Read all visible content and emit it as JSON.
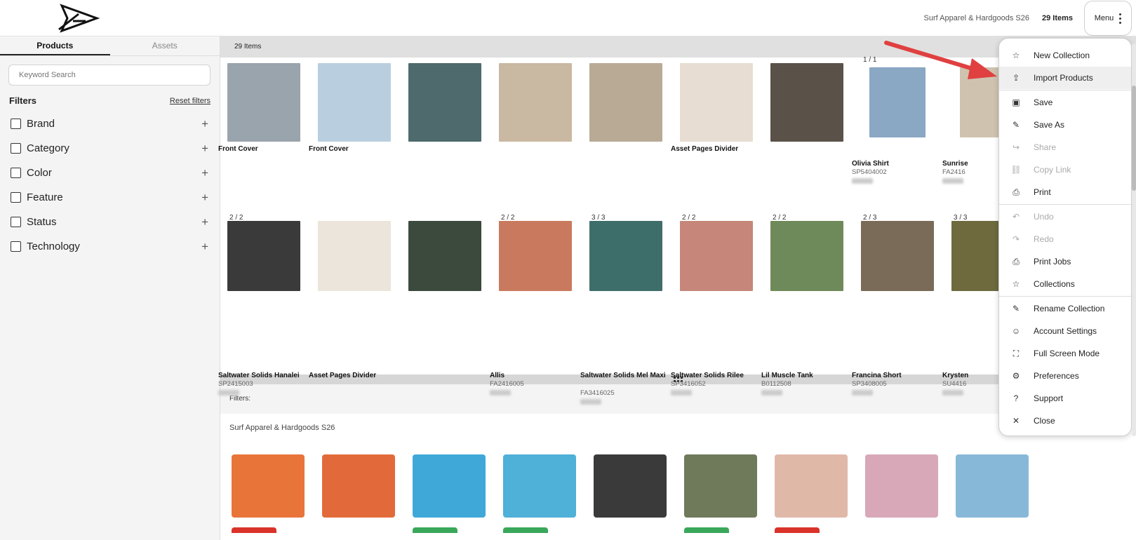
{
  "header": {
    "collection_name": "Surf Apparel & Hardgoods S26",
    "items_count": "29 Items",
    "menu_label": "Menu"
  },
  "sidebar": {
    "tabs": [
      {
        "label": "Products",
        "active": true
      },
      {
        "label": "Assets",
        "active": false
      }
    ],
    "search_placeholder": "Keyword Search",
    "filters_title": "Filters",
    "reset_filters": "Reset filters",
    "filters": [
      {
        "label": "Brand"
      },
      {
        "label": "Category"
      },
      {
        "label": "Color"
      },
      {
        "label": "Feature"
      },
      {
        "label": "Status"
      },
      {
        "label": "Technology"
      }
    ]
  },
  "main": {
    "items_bar": "29 Items",
    "row1": [
      {
        "pager": "",
        "title": "Front Cover",
        "sku": "",
        "color": "#9aa4ad"
      },
      {
        "pager": "",
        "title": "Front Cover",
        "sku": "",
        "color": "#b9cfe0"
      },
      {
        "pager": "",
        "title": "",
        "sku": "",
        "color": "#4e6a6c"
      },
      {
        "pager": "",
        "title": "",
        "sku": "",
        "color": "#c9b8a2"
      },
      {
        "pager": "",
        "title": "",
        "sku": "",
        "color": "#b9aa96"
      },
      {
        "pager": "",
        "title": "Asset Pages Divider",
        "sku": "",
        "color": "#e7ddd2"
      },
      {
        "pager": "",
        "title": "",
        "sku": "",
        "color": "#5a5148"
      },
      {
        "pager": "1 / 1",
        "title": "Olivia Shirt",
        "sku": "SP5404002",
        "color": "#8aa7c3"
      },
      {
        "pager": "",
        "title": "Sunrise",
        "sku": "FA2416",
        "color": "#cfc3b0"
      }
    ],
    "row2": [
      {
        "pager": "2 / 2",
        "title": "Saltwater Solids Hanalei",
        "sku": "SP2415003",
        "color": "#3a3a3a"
      },
      {
        "pager": "",
        "title": "Asset Pages Divider",
        "sku": "",
        "color": "#ece5dc"
      },
      {
        "pager": "",
        "title": "",
        "sku": "",
        "color": "#3b4a3c"
      },
      {
        "pager": "2 / 2",
        "title": "Allis",
        "sku": "FA2416005",
        "color": "#c97a5e"
      },
      {
        "pager": "3 / 3",
        "title": "Saltwater Solids Mel Maxi",
        "sku": "FA3416025",
        "color": "#3e6e6a"
      },
      {
        "pager": "2 / 2",
        "title": "Saltwater Solids Rilee",
        "sku": "SP3416052",
        "color": "#c6867a"
      },
      {
        "pager": "2 / 2",
        "title": "Lil Muscle Tank",
        "sku": "B0112508",
        "color": "#6f8a5a"
      },
      {
        "pager": "2 / 3",
        "title": "Francina Short",
        "sku": "SP3408005",
        "color": "#7a6a58"
      },
      {
        "pager": "3 / 3",
        "title": "Krysten",
        "sku": "SU4416",
        "color": "#6e6a3e"
      }
    ],
    "filters_line": "Filters:",
    "lower_collection": "Surf Apparel & Hardgoods S26",
    "lower_products": [
      {
        "color": "#e8743a",
        "tag": "#d9332a"
      },
      {
        "color": "#e26a3a",
        "tag": ""
      },
      {
        "color": "#3fa8d8",
        "tag": "#3aa85a"
      },
      {
        "color": "#4fb0d8",
        "tag": "#3aa85a"
      },
      {
        "color": "#3a3a3a",
        "tag": ""
      },
      {
        "color": "#6e7a5a",
        "tag": "#3aa85a"
      },
      {
        "color": "#e0b8a8",
        "tag": "#d9332a"
      },
      {
        "color": "#d8a8b8",
        "tag": ""
      },
      {
        "color": "#88b8d8",
        "tag": ""
      }
    ]
  },
  "menu": {
    "items": [
      {
        "label": "New Collection",
        "icon": "☆",
        "disabled": false,
        "highlight": false
      },
      {
        "label": "Import Products",
        "icon": "⇪",
        "disabled": false,
        "highlight": true
      },
      {
        "sep": true
      },
      {
        "label": "Save",
        "icon": "▣",
        "disabled": false,
        "highlight": false
      },
      {
        "label": "Save As",
        "icon": "✎",
        "disabled": false,
        "highlight": false
      },
      {
        "label": "Share",
        "icon": "↪",
        "disabled": true,
        "highlight": false
      },
      {
        "label": "Copy Link",
        "icon": "⛓",
        "disabled": true,
        "highlight": false
      },
      {
        "label": "Print",
        "icon": "⎙",
        "disabled": false,
        "highlight": false
      },
      {
        "sep": true
      },
      {
        "label": "Undo",
        "icon": "↶",
        "disabled": true,
        "highlight": false
      },
      {
        "label": "Redo",
        "icon": "↷",
        "disabled": true,
        "highlight": false
      },
      {
        "label": "Print Jobs",
        "icon": "⎙",
        "disabled": false,
        "highlight": false
      },
      {
        "label": "Collections",
        "icon": "☆",
        "disabled": false,
        "highlight": false
      },
      {
        "sep": true
      },
      {
        "label": "Rename Collection",
        "icon": "✎",
        "disabled": false,
        "highlight": false
      },
      {
        "label": "Account Settings",
        "icon": "☺",
        "disabled": false,
        "highlight": false
      },
      {
        "label": "Full Screen Mode",
        "icon": "⛶",
        "disabled": false,
        "highlight": false
      },
      {
        "label": "Preferences",
        "icon": "⚙",
        "disabled": false,
        "highlight": false
      },
      {
        "label": "Support",
        "icon": "?",
        "disabled": false,
        "highlight": false
      },
      {
        "label": "Close",
        "icon": "✕",
        "disabled": false,
        "highlight": false
      }
    ]
  },
  "colors": {
    "accent_arrow": "#e04040",
    "sidebar_bg": "#f4f4f4",
    "bar_bg": "#e0e0e0"
  }
}
